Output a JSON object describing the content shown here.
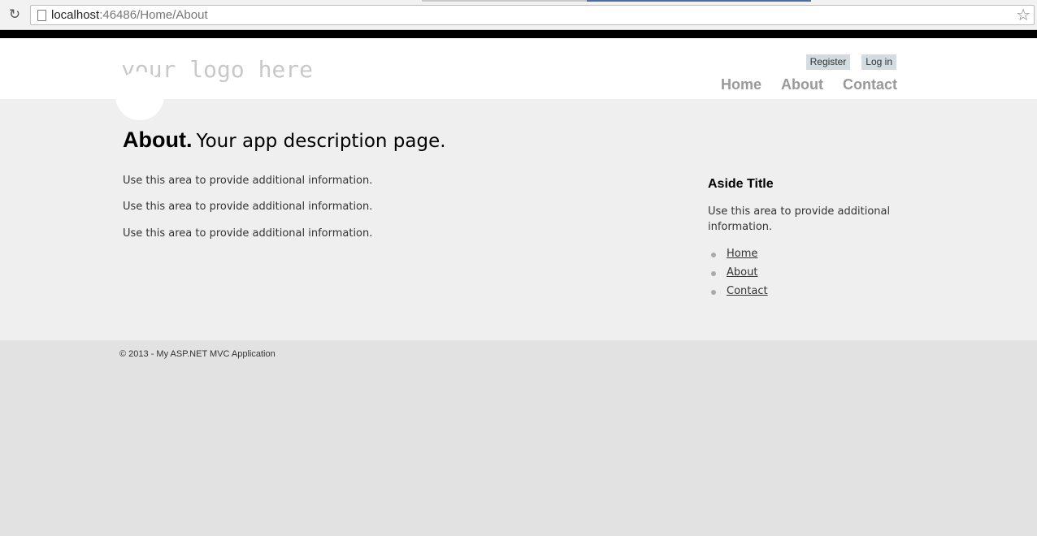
{
  "browser": {
    "url_host": "localhost",
    "url_rest": ":46486/Home/About"
  },
  "header": {
    "logo_text": "your logo here",
    "login_links": [
      "Register",
      "Log in"
    ],
    "nav": [
      "Home",
      "About",
      "Contact"
    ]
  },
  "main": {
    "title_strong": "About.",
    "title_rest": "Your app description page.",
    "paragraphs": [
      "Use this area to provide additional information.",
      "Use this area to provide additional information.",
      "Use this area to provide additional information."
    ]
  },
  "aside": {
    "title": "Aside Title",
    "text": "Use this area to provide additional information.",
    "links": [
      "Home",
      "About",
      "Contact"
    ]
  },
  "footer": {
    "text": "© 2013 - My ASP.NET MVC Application"
  }
}
